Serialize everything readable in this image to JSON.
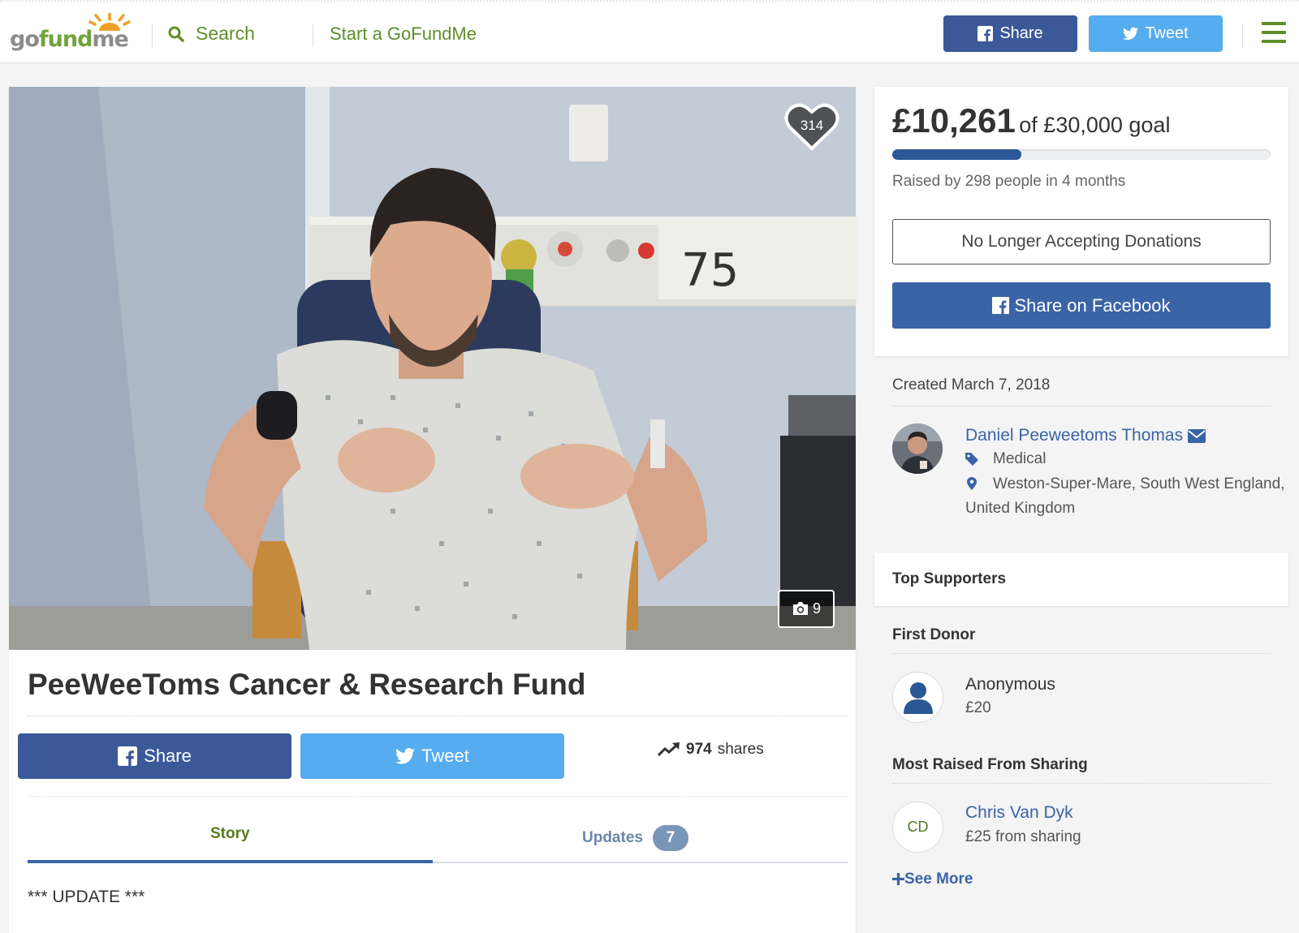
{
  "header": {
    "logo": {
      "part1": "go",
      "part2": "fund",
      "part3": "me"
    },
    "search_label": "Search",
    "start_label": "Start a GoFundMe",
    "share_label": "Share",
    "tweet_label": "Tweet",
    "colors": {
      "facebook": "#3b5998",
      "twitter": "#55acee",
      "brand_green": "#5f8f2a"
    }
  },
  "campaign": {
    "hero_wall_number": "75",
    "hearts": "314",
    "photo_count": "9",
    "title": "PeeWeeToms Cancer & Research Fund",
    "share_label": "Share",
    "tweet_label": "Tweet",
    "share_count": "974",
    "shares_word": "shares",
    "tabs": [
      {
        "label": "Story",
        "active": true
      },
      {
        "label": "Updates",
        "badge": "7",
        "active": false
      }
    ],
    "story_first_line": "*** UPDATE ***"
  },
  "donation": {
    "raised": "£10,261",
    "goal_text": "of £30,000 goal",
    "progress_fraction": 0.342,
    "raised_by": "Raised by 298 people in 4 months",
    "status_button": "No Longer Accepting Donations",
    "share_facebook": "Share on Facebook"
  },
  "organizer": {
    "created": "Created March 7, 2018",
    "name": "Daniel Peeweetoms Thomas",
    "category": "Medical",
    "location": "Weston-Super-Mare, South West England, United Kingdom"
  },
  "supporters": {
    "title": "Top Supporters",
    "first_donor_heading": "First Donor",
    "first_donor_name": "Anonymous",
    "first_donor_amount": "£20",
    "most_raised_heading": "Most Raised From Sharing",
    "sharer_initials": "CD",
    "sharer_name": "Chris Van Dyk",
    "sharer_amount": "£25 from sharing",
    "see_more": "See More"
  }
}
